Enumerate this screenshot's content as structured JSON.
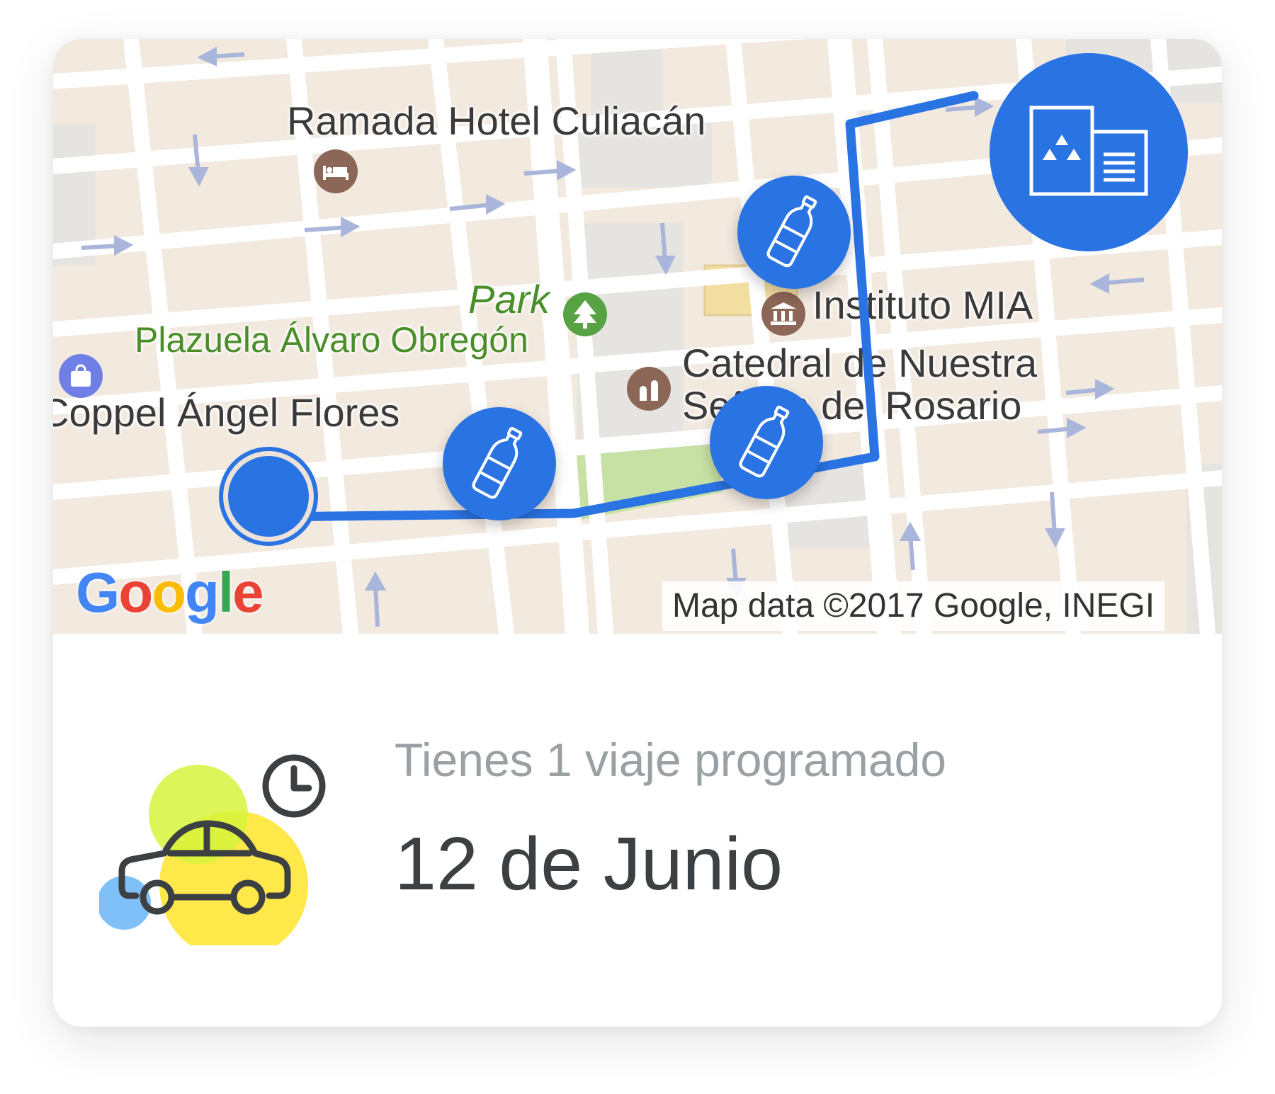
{
  "map": {
    "labels": {
      "hotel": "Ramada Hotel Culiacán",
      "park_short": "Park",
      "plaza": "Plazuela Álvaro Obregón",
      "store": "Coppel Ángel Flores",
      "institute": "Instituto MIA",
      "cathedral_line1": "Catedral de Nuestra",
      "cathedral_line2": "Señora del Rosario"
    },
    "logo": "Google",
    "attribution": "Map data ©2017 Google, INEGI",
    "colors": {
      "route": "#2a73e3",
      "land": "#f2e9df",
      "road": "#ffffff",
      "block": "#e7e4df",
      "park_area": "#c7e1a4"
    },
    "markers": [
      {
        "icon": "bottle-icon"
      },
      {
        "icon": "bottle-icon"
      },
      {
        "icon": "bottle-icon"
      }
    ],
    "destination_icon": "recycling-center-icon"
  },
  "trip": {
    "subtitle": "Tienes 1 viaje programado",
    "date": "12 de Junio"
  },
  "illustration": {
    "icon": "scheduled-car-icon",
    "colors": [
      "#d6f53c",
      "#ffe84a",
      "#7ec0f7",
      "#3d4042"
    ]
  }
}
